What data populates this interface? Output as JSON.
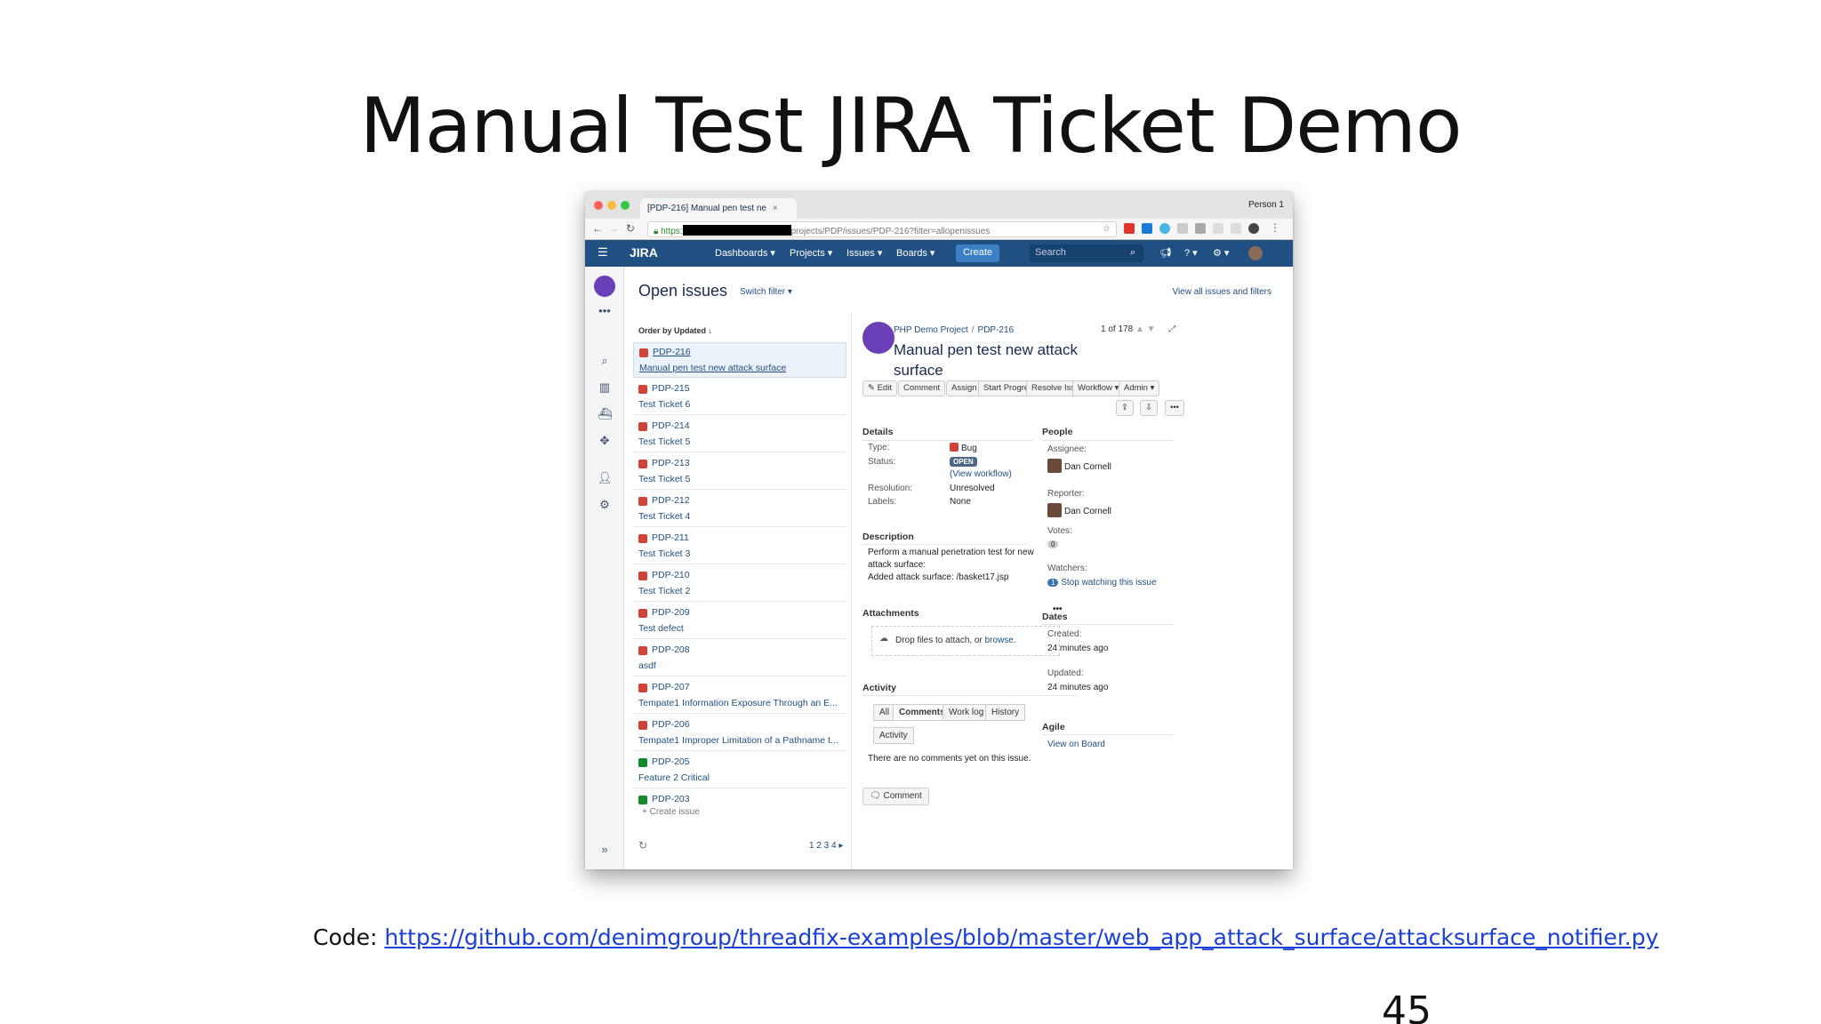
{
  "slide": {
    "title": "Manual Test JIRA Ticket Demo",
    "footer_prefix": "Code: ",
    "footer_link": "https://github.com/denimgroup/threadfix-examples/blob/master/web_app_attack_surface/attacksurface_notifier.py",
    "page_number": "45"
  },
  "browser": {
    "tab_title": "[PDP-216] Manual pen test ne",
    "tab_close": "×",
    "profile": "Person 1",
    "url_scheme": "https:",
    "url_path": "projects/PDP/issues/PDP-216?filter=allopenissues"
  },
  "jira_nav": {
    "logo": "JIRA",
    "menus": [
      "Dashboards ▾",
      "Projects ▾",
      "Issues ▾",
      "Boards ▾"
    ],
    "create": "Create",
    "search_placeholder": "Search"
  },
  "issues_header": {
    "title": "Open issues",
    "switch_filter": "Switch filter ▾",
    "view_all": "View all issues and filters",
    "order_by": "Order by Updated ↓"
  },
  "issue_list": [
    {
      "key": "PDP-216",
      "summary": "Manual pen test new attack surface",
      "type": "bug"
    },
    {
      "key": "PDP-215",
      "summary": "Test Ticket 6",
      "type": "bug"
    },
    {
      "key": "PDP-214",
      "summary": "Test Ticket 5",
      "type": "bug"
    },
    {
      "key": "PDP-213",
      "summary": "Test Ticket 5",
      "type": "bug"
    },
    {
      "key": "PDP-212",
      "summary": "Test Ticket 4",
      "type": "bug"
    },
    {
      "key": "PDP-211",
      "summary": "Test Ticket 3",
      "type": "bug"
    },
    {
      "key": "PDP-210",
      "summary": "Test Ticket 2",
      "type": "bug"
    },
    {
      "key": "PDP-209",
      "summary": "Test defect",
      "type": "bug"
    },
    {
      "key": "PDP-208",
      "summary": "asdf",
      "type": "bug"
    },
    {
      "key": "PDP-207",
      "summary": "Tempate1 Information Exposure Through an E...",
      "type": "bug"
    },
    {
      "key": "PDP-206",
      "summary": "Tempate1 Improper Limitation of a Pathname t...",
      "type": "bug"
    },
    {
      "key": "PDP-205",
      "summary": "Feature 2 Critical",
      "type": "feature"
    },
    {
      "key": "PDP-203",
      "summary": "",
      "type": "feature"
    }
  ],
  "list_footer": {
    "create_issue": "+ Create issue",
    "pages": "1 2 3 4 ▸"
  },
  "issue": {
    "project": "PHP Demo Project",
    "key": "PDP-216",
    "title": "Manual pen test new attack surface",
    "counter": "1 of 178",
    "buttons": [
      "✎ Edit",
      "Comment",
      "Assign",
      "Start Progress",
      "Resolve Issue",
      "Workflow ▾",
      "Admin ▾"
    ],
    "details_heading": "Details",
    "type_label": "Type:",
    "type_value": "Bug",
    "status_label": "Status:",
    "status_value": "OPEN",
    "view_workflow": "(View workflow)",
    "resolution_label": "Resolution:",
    "resolution_value": "Unresolved",
    "labels_label": "Labels:",
    "labels_value": "None",
    "description_heading": "Description",
    "description_lines": [
      "Perform a manual penetration test for new",
      "attack surface:",
      "Added attack surface: /basket17.jsp"
    ],
    "attachments_heading": "Attachments",
    "drop_text": "Drop files to attach, or ",
    "browse": "browse.",
    "activity_heading": "Activity",
    "activity_tabs": [
      "All",
      "Comments",
      "Work log",
      "History",
      "Activity"
    ],
    "no_comments": "There are no comments yet on this issue.",
    "comment_button": "Comment",
    "people_heading": "People",
    "assignee_label": "Assignee:",
    "assignee": "Dan Cornell",
    "reporter_label": "Reporter:",
    "reporter": "Dan Cornell",
    "votes_label": "Votes:",
    "votes": "0",
    "watchers_label": "Watchers:",
    "watchers_count": "1",
    "stop_watching": "Stop watching this issue",
    "dates_heading": "Dates",
    "created_label": "Created:",
    "created": "24 minutes ago",
    "updated_label": "Updated:",
    "updated": "24 minutes ago",
    "agile_heading": "Agile",
    "view_on_board": "View on Board"
  },
  "colors": {
    "jira_nav": "#205081",
    "bug": "#d04437",
    "feature": "#14892c",
    "link": "#205081"
  }
}
